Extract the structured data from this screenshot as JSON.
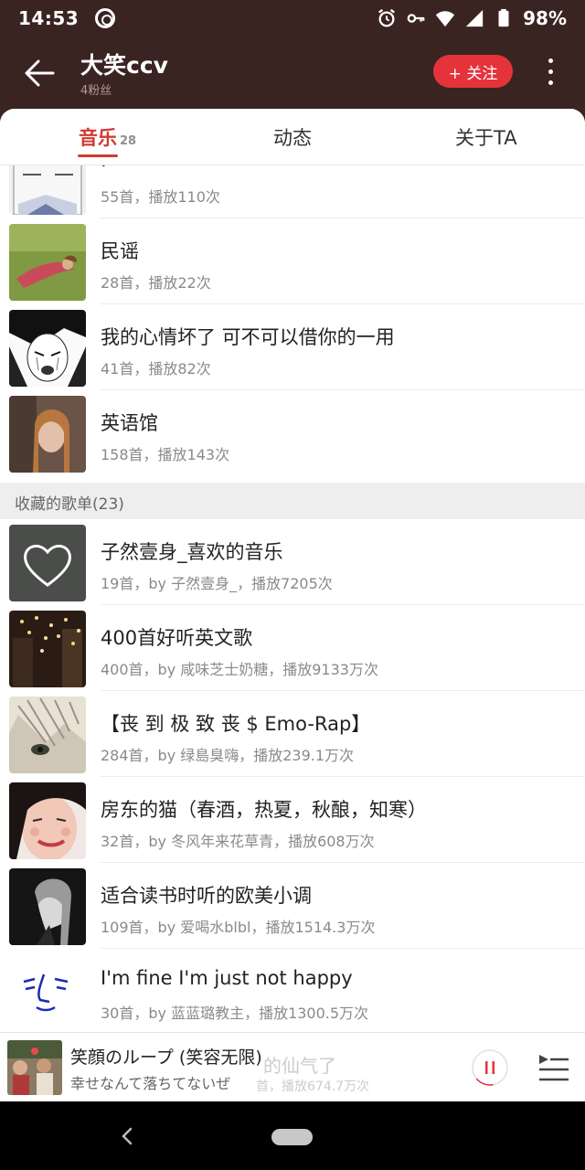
{
  "status_bar": {
    "time": "14:53",
    "battery": "98%"
  },
  "header": {
    "title": "大笑ccv",
    "subtitle": "4粉丝",
    "follow_label": "+ 关注"
  },
  "tabs": [
    {
      "label": "音乐",
      "count": "28"
    },
    {
      "label": "动态"
    },
    {
      "label": "关于TA"
    }
  ],
  "created_playlists": [
    {
      "name": ".",
      "meta": "55首，播放110次"
    },
    {
      "name": "民谣",
      "meta": "28首，播放22次"
    },
    {
      "name": "我的心情坏了 可不可以借你的一用",
      "meta": "41首，播放82次"
    },
    {
      "name": "英语馆",
      "meta": "158首，播放143次"
    }
  ],
  "collected_section": {
    "label": "收藏的歌单(23)"
  },
  "collected_playlists": [
    {
      "name": "子然壹身_喜欢的音乐",
      "meta": "19首，by 子然壹身_，播放7205次"
    },
    {
      "name": "400首好听英文歌",
      "meta": "400首，by 咸味芝士奶糖，播放9133万次"
    },
    {
      "name": "【丧 到 极 致 丧 $ Emo-Rap】",
      "meta": "284首，by 绿島臭嗨，播放239.1万次"
    },
    {
      "name": "房东的猫（春酒，热夏，秋酿，知寒）",
      "meta": "32首，by 冬风年来花草青，播放608万次"
    },
    {
      "name": "适合读书时听的欧美小调",
      "meta": "109首，by 爱喝水blbl，播放1514.3万次"
    },
    {
      "name": "I'm fine I'm just not happy",
      "meta": "30首，by 蓝蓝璐教主，播放1300.5万次"
    }
  ],
  "player": {
    "song": "笑顔のループ (笑容无限)",
    "lyric": "幸せなんて落ちてないぜ",
    "behind_title": "的仙气了",
    "behind_meta": "首，播放674.7万次"
  },
  "colors": {
    "accent": "#d33a31",
    "header_bg": "#3a2421",
    "follow_bg": "#e5333b"
  }
}
